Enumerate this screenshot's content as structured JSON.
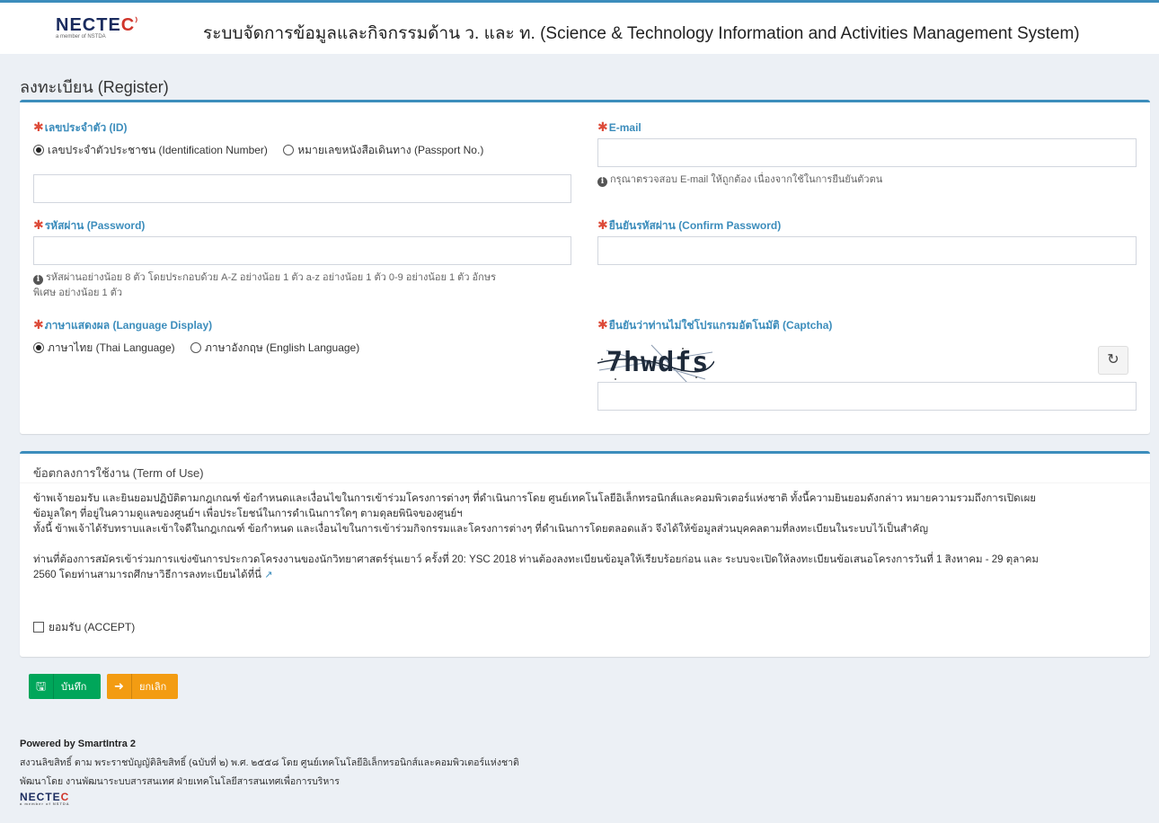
{
  "header": {
    "logo_text_main": "NECTE",
    "logo_text_end": "C",
    "logo_sub": "a member of NSTDA",
    "system_title": "ระบบจัดการข้อมูลและกิจกรรมด้าน ว. และ ท. (Science & Technology Information and Activities Management System)"
  },
  "page_title": "ลงทะเบียน (Register)",
  "form": {
    "required_mark": "✱",
    "id": {
      "label": "เลขประจำตัว (ID)",
      "option_citizen": "เลขประจำตัวประชาชน (Identification Number)",
      "option_passport": "หมายเลขหนังสือเดินทาง (Passport No.)",
      "value": ""
    },
    "email": {
      "label": "E-mail",
      "value": "",
      "help": "กรุณาตรวจสอบ E-mail ให้ถูกต้อง เนื่องจากใช้ในการยืนยันตัวตน"
    },
    "password": {
      "label": "รหัสผ่าน (Password)",
      "value": "",
      "help_line1": "รหัสผ่านอย่างน้อย 8 ตัว โดยประกอบด้วย A-Z อย่างน้อย 1 ตัว a-z อย่างน้อย 1 ตัว 0-9 อย่างน้อย 1 ตัว อักษร",
      "help_line2": "พิเศษ อย่างน้อย 1 ตัว"
    },
    "confirm_password": {
      "label": "ยืนยันรหัสผ่าน (Confirm Password)",
      "value": ""
    },
    "language": {
      "label": "ภาษาแสดงผล (Language Display)",
      "option_thai": "ภาษาไทย (Thai Language)",
      "option_english": "ภาษาอังกฤษ (English Language)"
    },
    "captcha": {
      "label": "ยืนยันว่าท่านไม่ใช่โปรแกรมอัตโนมัติ (Captcha)",
      "text": "7hwdfs",
      "refresh_icon": "refresh-icon",
      "value": ""
    }
  },
  "terms": {
    "title": "ข้อตกลงการใช้งาน (Term of Use)",
    "para1_line1": "ข้าพเจ้ายอมรับ และยินยอมปฏิบัติตามกฎเกณฑ์ ข้อกำหนดและเงื่อนไขในการเข้าร่วมโครงการต่างๆ ที่ดำเนินการโดย ศูนย์เทคโนโลยีอิเล็กทรอนิกส์และคอมพิวเตอร์แห่งชาติ ทั้งนี้ความยินยอมดังกล่าว หมายความรวมถึงการเปิดเผย",
    "para1_line2": "ข้อมูลใดๆ ที่อยู่ในความดูแลของศูนย์ฯ เพื่อประโยชน์ในการดำเนินการใดๆ ตามดุลยพินิจของศูนย์ฯ",
    "para1_line3": "ทั้งนี้ ข้าพเจ้าได้รับทราบและเข้าใจดีในกฎเกณฑ์ ข้อกำหนด และเงื่อนไขในการเข้าร่วมกิจกรรมและโครงการต่างๆ ที่ดำเนินการโดยตลอดแล้ว จึงได้ให้ข้อมูลส่วนบุคคลตามที่ลงทะเบียนในระบบไว้เป็นสำคัญ",
    "para2_line1": "ท่านที่ต้องการสมัครเข้าร่วมการแข่งขันการประกวดโครงงานของนักวิทยาศาสตร์รุ่นเยาว์ ครั้งที่ 20: YSC 2018 ท่านต้องลงทะเบียนข้อมูลให้เรียบร้อยก่อน และ ระบบจะเปิดให้ลงทะเบียนข้อเสนอโครงการวันที่ 1 สิงหาคม - 29 ตุลาคม",
    "para2_line2": "2560 โดยท่านสามารถศึกษาวิธีการลงทะเบียนได้ที่นี่",
    "external_link_icon": "external-link-icon",
    "accept_label": "ยอมรับ (ACCEPT)"
  },
  "buttons": {
    "save_label": "บันทึก",
    "save_icon": "save-icon",
    "cancel_label": "ยกเลิก",
    "cancel_icon": "sign-out-icon"
  },
  "footer": {
    "powered_by": "Powered by SmartIntra 2",
    "copyright": "สงวนลิขสิทธิ์ ตาม พระราชบัญญัติลิขสิทธิ์ (ฉบับที่ ๒) พ.ศ. ๒๕๕๘ โดย ศูนย์เทคโนโลยีอิเล็กทรอนิกส์และคอมพิวเตอร์แห่งชาติ",
    "developed_by": "พัฒนาโดย งานพัฒนาระบบสารสนเทศ ฝ่ายเทคโนโลยีสารสนเทศเพื่อการบริหาร"
  },
  "colors": {
    "primary": "#3c8dbc",
    "required": "#dd4b39",
    "save": "#00a65a",
    "cancel": "#f39c12",
    "background": "#ecf0f5"
  }
}
